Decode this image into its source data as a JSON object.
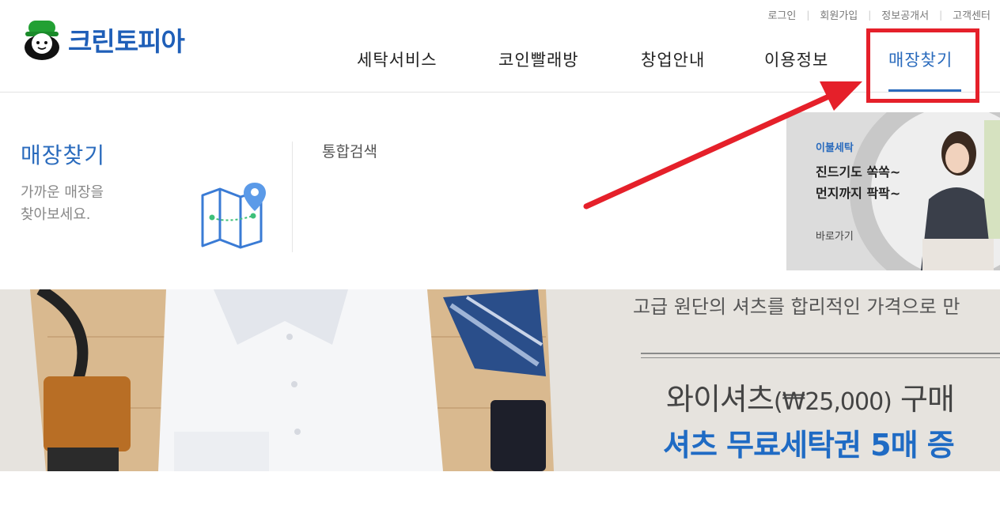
{
  "brand": {
    "name": "크린토피아",
    "color": "#1f5fb8"
  },
  "util_nav": [
    "로그인",
    "회원가입",
    "정보공개서",
    "고객센터"
  ],
  "main_nav": [
    {
      "label": "세탁서비스",
      "active": false
    },
    {
      "label": "코인빨래방",
      "active": false
    },
    {
      "label": "창업안내",
      "active": false
    },
    {
      "label": "이용정보",
      "active": false
    },
    {
      "label": "매장찾기",
      "active": true
    }
  ],
  "dropdown": {
    "title": "매장찾기",
    "description_line1": "가까운 매장을",
    "description_line2": "찾아보세요.",
    "link": "통합검색"
  },
  "promo": {
    "tag": "이불세탁",
    "line1": "진드기도 쏙쏙~",
    "line2": "먼지까지 팍팍~",
    "cta": "바로가기"
  },
  "banner": {
    "tagline": "고급 원단의 셔츠를 합리적인 가격으로 만",
    "offer_main": "와이셔츠",
    "offer_price": "(₩25,000)",
    "offer_tail": "구매",
    "free_text": "셔츠 무료세탁권 5매 증"
  },
  "colors": {
    "accent": "#2a6bbd",
    "highlight": "#e5202a"
  }
}
